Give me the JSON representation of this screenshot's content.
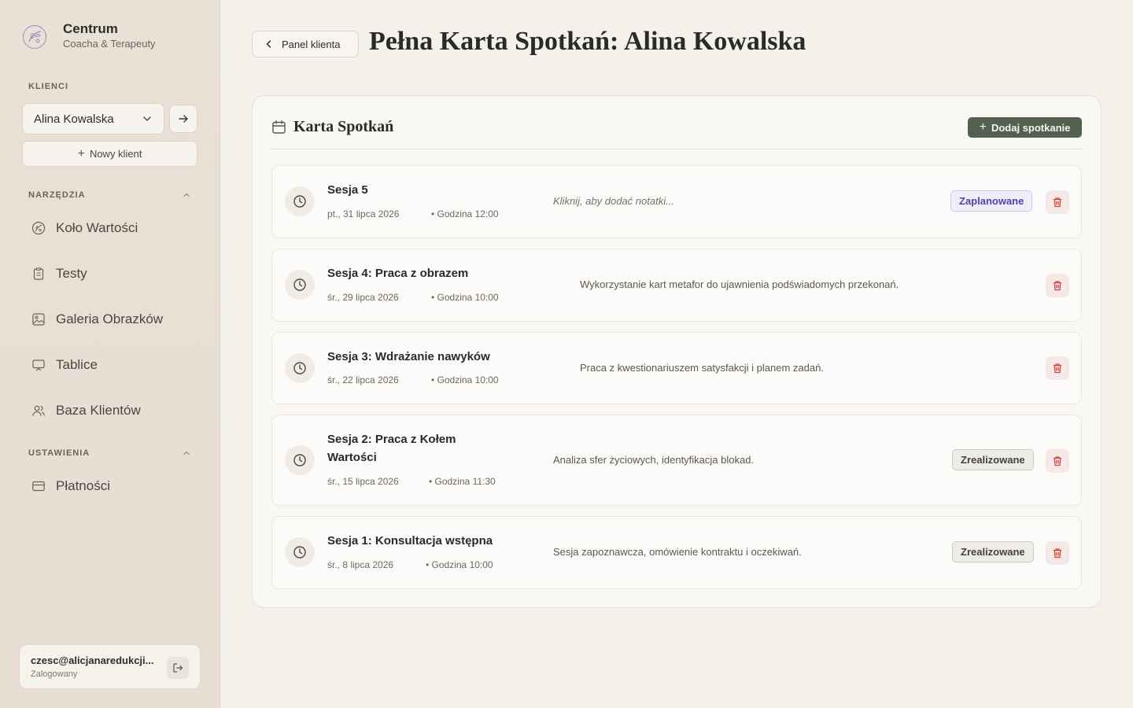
{
  "brand": {
    "title": "Centrum",
    "subtitle": "Coacha & Terapeuty"
  },
  "sidebar": {
    "clients_label": "KLIENCI",
    "selected_client": "Alina Kowalska",
    "new_client_label": "Nowy klient",
    "tools_label": "NARZĘDZIA",
    "tools": [
      {
        "label": "Koło Wartości",
        "icon": "wheel-icon"
      },
      {
        "label": "Testy",
        "icon": "clipboard-icon"
      },
      {
        "label": "Galeria Obrazków",
        "icon": "image-icon"
      },
      {
        "label": "Tablice",
        "icon": "board-icon"
      },
      {
        "label": "Baza Klientów",
        "icon": "users-icon"
      }
    ],
    "settings_label": "USTAWIENIA",
    "settings": [
      {
        "label": "Płatności",
        "icon": "credit-card-icon"
      }
    ]
  },
  "user": {
    "email": "czesc@alicjanaredukcji...",
    "status": "Zalogowany"
  },
  "header": {
    "back_label": "Panel klienta",
    "title_bold": "Pełna Karta Spotkań:",
    "title_name": "Alina Kowalska"
  },
  "card": {
    "title": "Karta Spotkań",
    "add_label": "Dodaj spotkanie",
    "sessions": [
      {
        "title": "Sesja 5",
        "date": "pt., 31 lipca 2026",
        "time": "• Godzina 12:00",
        "note": "Kliknij, aby dodać notatki...",
        "badge": "Zaplanowane"
      },
      {
        "title": "Sesja 4: Praca z obrazem",
        "date": "śr., 29 lipca 2026",
        "time": "• Godzina 10:00",
        "note": "Wykorzystanie kart metafor do ujawnienia podświadomych przekonań.",
        "badge": ""
      },
      {
        "title": "Sesja 3: Wdrażanie nawyków",
        "date": "śr., 22 lipca 2026",
        "time": "• Godzina 10:00",
        "note": "Praca z kwestionariuszem satysfakcji i planem zadań.",
        "badge": ""
      },
      {
        "title": "Sesja 2: Praca z Kołem Wartości",
        "date": "śr., 15 lipca 2026",
        "time": "• Godzina 11:30",
        "note": "Analiza sfer życiowych, identyfikacja blokad.",
        "badge": "Zrealizowane"
      },
      {
        "title": "Sesja 1: Konsultacja wstępna",
        "date": "śr., 8 lipca 2026",
        "time": "• Godzina 10:00",
        "note": "Sesja zapoznawcza, omówienie kontraktu i oczekiwań.",
        "badge": "Zrealizowane"
      }
    ]
  },
  "colors": {
    "accent": "#556150",
    "planned": "#4a47a8",
    "danger": "#d0453d"
  }
}
